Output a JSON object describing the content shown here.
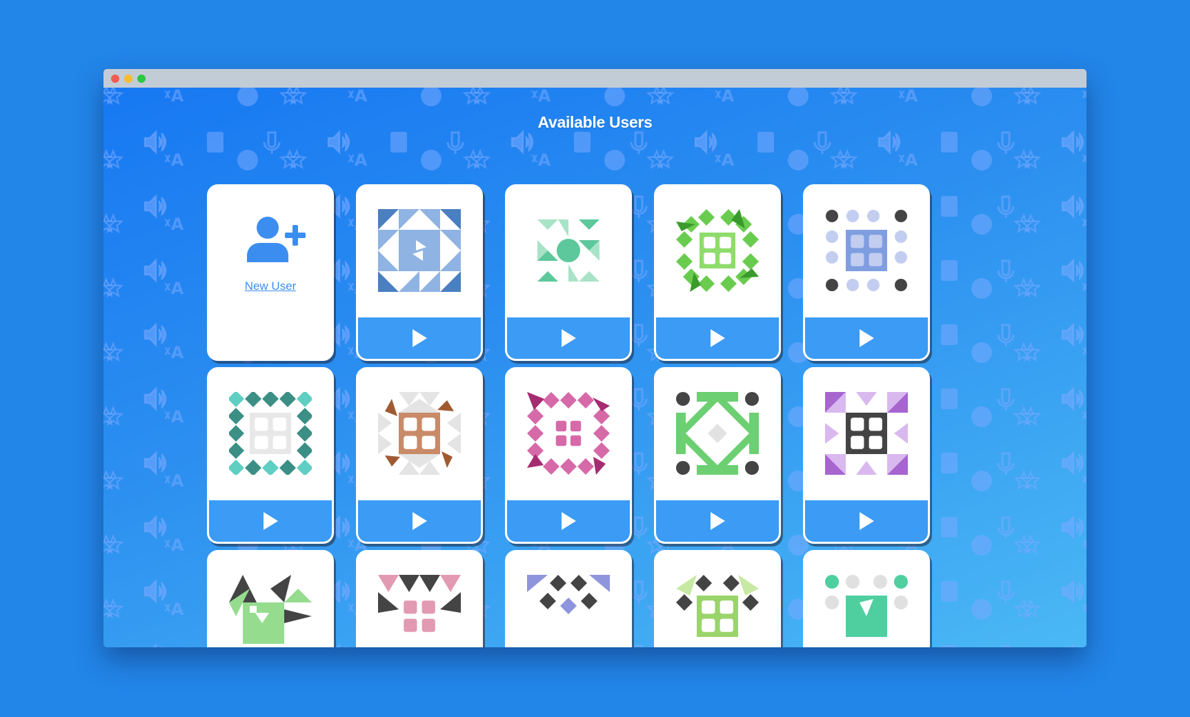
{
  "page": {
    "title": "Available Users"
  },
  "new_user": {
    "label": "New User",
    "icon": "add-user-icon"
  },
  "play_icon": "play-icon",
  "colors": {
    "accent": "#3b9bf5",
    "background": "#2285e8",
    "link": "#3b8ef0"
  },
  "users": [
    {
      "avatar": "quilt-blue",
      "color": "#4a7fc1"
    },
    {
      "avatar": "quilt-mint",
      "color": "#5cc89b"
    },
    {
      "avatar": "quilt-green",
      "color": "#6acc4f"
    },
    {
      "avatar": "quilt-periwinkle",
      "color": "#7f9ee0"
    },
    {
      "avatar": "quilt-teal",
      "color": "#3b8f85"
    },
    {
      "avatar": "quilt-copper",
      "color": "#c98a68"
    },
    {
      "avatar": "quilt-magenta",
      "color": "#d66aa8"
    },
    {
      "avatar": "quilt-lime",
      "color": "#6ccf72"
    },
    {
      "avatar": "quilt-purple",
      "color": "#a765cf"
    },
    {
      "avatar": "quilt-darkgreen",
      "color": "#95dc8f"
    },
    {
      "avatar": "quilt-pink",
      "color": "#e29ab3"
    },
    {
      "avatar": "quilt-indigo",
      "color": "#8e95dc"
    },
    {
      "avatar": "quilt-yellowgreen",
      "color": "#9ad46a"
    },
    {
      "avatar": "quilt-seafoam",
      "color": "#4fcfa0"
    }
  ]
}
